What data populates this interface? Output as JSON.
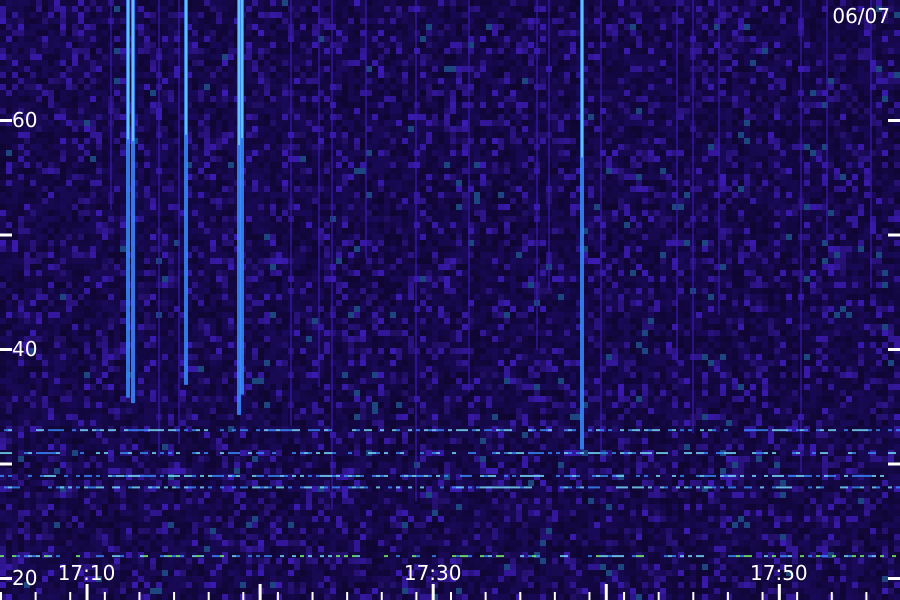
{
  "chart_data": {
    "type": "heatmap",
    "date_label": "06/07",
    "y_axis": {
      "unit": "",
      "range": [
        20,
        70
      ],
      "ticks": [
        20,
        30,
        40,
        50,
        60
      ],
      "labels": [
        "20",
        "",
        "40",
        "",
        "60"
      ]
    },
    "x_axis": {
      "range": [
        "17:05",
        "17:57"
      ],
      "labels": [
        "17:10",
        "17:30",
        "17:50"
      ],
      "major_ticks": [
        "17:10",
        "17:20",
        "17:30",
        "17:40",
        "17:50"
      ]
    },
    "colors": {
      "background": "#000000",
      "noise_low": "#1a0a5a",
      "noise_mid": "#3a1ab0",
      "signal": "#3a8cff",
      "strong": "#78e0ff",
      "peak": "#7dff6a",
      "text": "#ffffff"
    },
    "bright_bands_freq": [
      22,
      28,
      29,
      31,
      33
    ],
    "grid": false
  }
}
